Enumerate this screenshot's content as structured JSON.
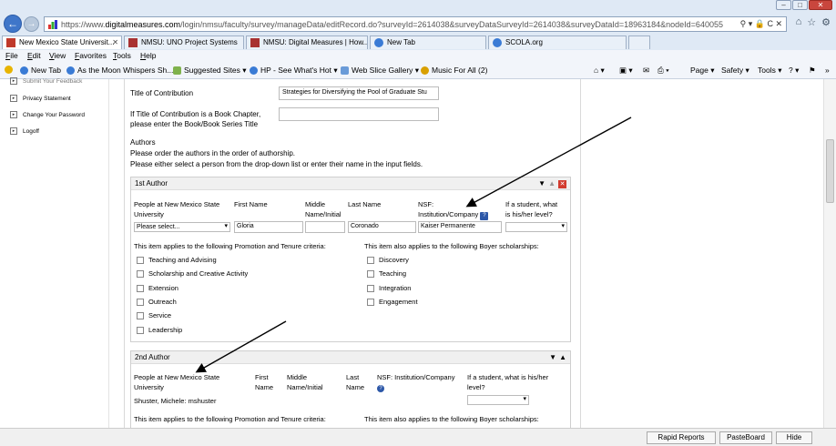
{
  "browser": {
    "url_prefix": "https://www.",
    "url_domain": "digitalmeasures.com",
    "url_rest": "/login/nmsu/faculty/survey/manageData/editRecord.do?surveyId=2614038&surveyDataSurveyId=2614038&surveyDataId=18963184&nodeId=640055",
    "addr_controls": "⚲ ▾ 🔒 C ✕",
    "tabs": [
      {
        "label": "New Mexico State Universit...",
        "color": "#c0392b"
      },
      {
        "label": "NMSU: UNO Project Systems",
        "color": "#a83232"
      },
      {
        "label": "NMSU: Digital Measures | How...",
        "color": "#a83232"
      },
      {
        "label": "New Tab",
        "color": "#3a7bd5"
      },
      {
        "label": "SCOLA.org",
        "color": "#3a7bd5"
      }
    ],
    "menu": [
      "File",
      "Edit",
      "View",
      "Favorites",
      "Tools",
      "Help"
    ],
    "favorites": [
      {
        "label": "New Tab"
      },
      {
        "label": "As the Moon Whispers Sh..."
      },
      {
        "label": "Suggested Sites ▾"
      },
      {
        "label": "HP - See What's Hot ▾"
      },
      {
        "label": "Web Slice Gallery ▾"
      },
      {
        "label": "Music For All (2)"
      }
    ],
    "commands": {
      "page": "Page ▾",
      "safety": "Safety ▾",
      "tools": "Tools ▾",
      "help": "? ▾"
    }
  },
  "sidebar": {
    "items": [
      {
        "label": "Submit Your Feedback"
      },
      {
        "label": "Privacy Statement"
      },
      {
        "label": "Change Your Password"
      },
      {
        "label": "Logoff"
      }
    ]
  },
  "form": {
    "title_label": "Title of Contribution",
    "title_value": "Strategies for Diversifying the Pool of Graduate Stu",
    "book_label_1": "If Title of Contribution is a Book Chapter,",
    "book_label_2": "please enter the Book/Book Series Title",
    "authors_heading": "Authors",
    "authors_line1": "Please order the authors in the order of authorship.",
    "authors_line2": "Please either select a person from the drop-down list or enter their name in the input fields."
  },
  "author1": {
    "heading": "1st Author",
    "col_people_1": "People at New Mexico State",
    "col_people_2": "University",
    "col_first": "First Name",
    "col_middle_1": "Middle",
    "col_middle_2": "Name/Initial",
    "col_last": "Last Name",
    "col_nsf_1": "NSF:",
    "col_nsf_2": "Institution/Company",
    "col_student_1": "If a student, what",
    "col_student_2": "is his/her level?",
    "person_select": "Please select...",
    "first_name": "Gloria",
    "middle_name": "",
    "last_name": "Coronado",
    "institution": "Kaiser Permanente",
    "student_level": "",
    "promo_heading": "This item applies to the following Promotion and Tenure criteria:",
    "boyer_heading": "This item also applies to the following Boyer scholarships:",
    "promo_items": [
      "Teaching and Advising",
      "Scholarship and Creative Activity",
      "Extension",
      "Outreach",
      "Service",
      "Leadership"
    ],
    "boyer_items": [
      "Discovery",
      "Teaching",
      "Integration",
      "Engagement"
    ]
  },
  "author2": {
    "heading": "2nd Author",
    "col_people_1": "People at New Mexico State",
    "col_people_2": "University",
    "col_first_1": "First",
    "col_first_2": "Name",
    "col_middle_1": "Middle",
    "col_middle_2": "Name/Initial",
    "col_last_1": "Last",
    "col_last_2": "Name",
    "col_nsf": "NSF: Institution/Company",
    "col_student_1": "If a student, what is his/her",
    "col_student_2": "level?",
    "person_value": "Shuster, Michele: mshuster",
    "promo_heading": "This item applies to the following Promotion and Tenure criteria:",
    "boyer_heading": "This item also applies to the following Boyer scholarships:"
  },
  "bottombar": {
    "rapid_reports": "Rapid Reports",
    "pasteboard": "PasteBoard",
    "hide": "Hide"
  }
}
